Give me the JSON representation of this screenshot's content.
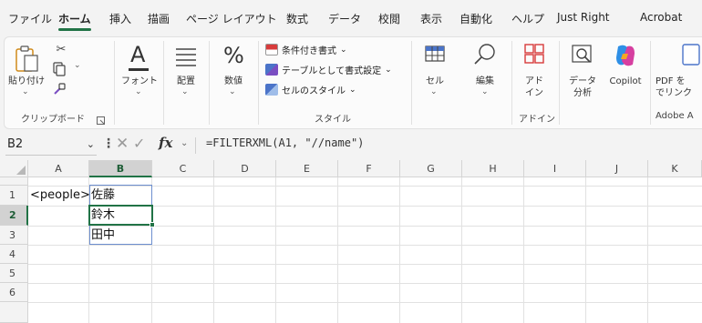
{
  "menu": {
    "tabs": [
      {
        "label": "ファイル"
      },
      {
        "label": "ホーム"
      },
      {
        "label": "挿入"
      },
      {
        "label": "描画"
      },
      {
        "label": "ページ レイアウト"
      },
      {
        "label": "数式"
      },
      {
        "label": "データ"
      },
      {
        "label": "校閲"
      },
      {
        "label": "表示"
      },
      {
        "label": "自動化"
      },
      {
        "label": "ヘルプ"
      },
      {
        "label": "Just Right"
      },
      {
        "label": "Acrobat"
      }
    ],
    "active_tab": "ホーム"
  },
  "ribbon": {
    "clipboard": {
      "paste_label": "貼り付け",
      "group_label": "クリップボード"
    },
    "font": {
      "label": "フォント"
    },
    "alignment": {
      "label": "配置"
    },
    "number": {
      "label": "数値"
    },
    "styles": {
      "conditional_label": "条件付き書式",
      "table_label": "テーブルとして書式設定",
      "cell_styles_label": "セルのスタイル",
      "group_label": "スタイル"
    },
    "cells": {
      "label": "セル"
    },
    "editing": {
      "label": "編集"
    },
    "addins": {
      "button_label_1": "アド",
      "button_label_2": "イン",
      "group_label": "アドイン"
    },
    "data_analysis": {
      "label_1": "データ",
      "label_2": "分析"
    },
    "copilot": {
      "label": "Copilot"
    },
    "adobe": {
      "label_1": "PDF を",
      "label_2": "でリンク",
      "group_label": "Adobe A"
    }
  },
  "formula_bar": {
    "name_box": "B2",
    "fx_label": "fx",
    "formula": "=FILTERXML(A1, \"//name\")"
  },
  "sheet": {
    "columns": [
      "A",
      "B",
      "C",
      "D",
      "E",
      "F",
      "G",
      "H",
      "I",
      "J",
      "K"
    ],
    "selected_column": "B",
    "rows": [
      "1",
      "2",
      "3",
      "4",
      "5",
      "6"
    ],
    "selected_row": "2",
    "cells": {
      "A1": "<people>",
      "B1": "佐藤",
      "B2": "鈴木",
      "B3": "田中"
    }
  },
  "colors": {
    "accent": "#217346",
    "spill_border": "#6d8fcf"
  }
}
